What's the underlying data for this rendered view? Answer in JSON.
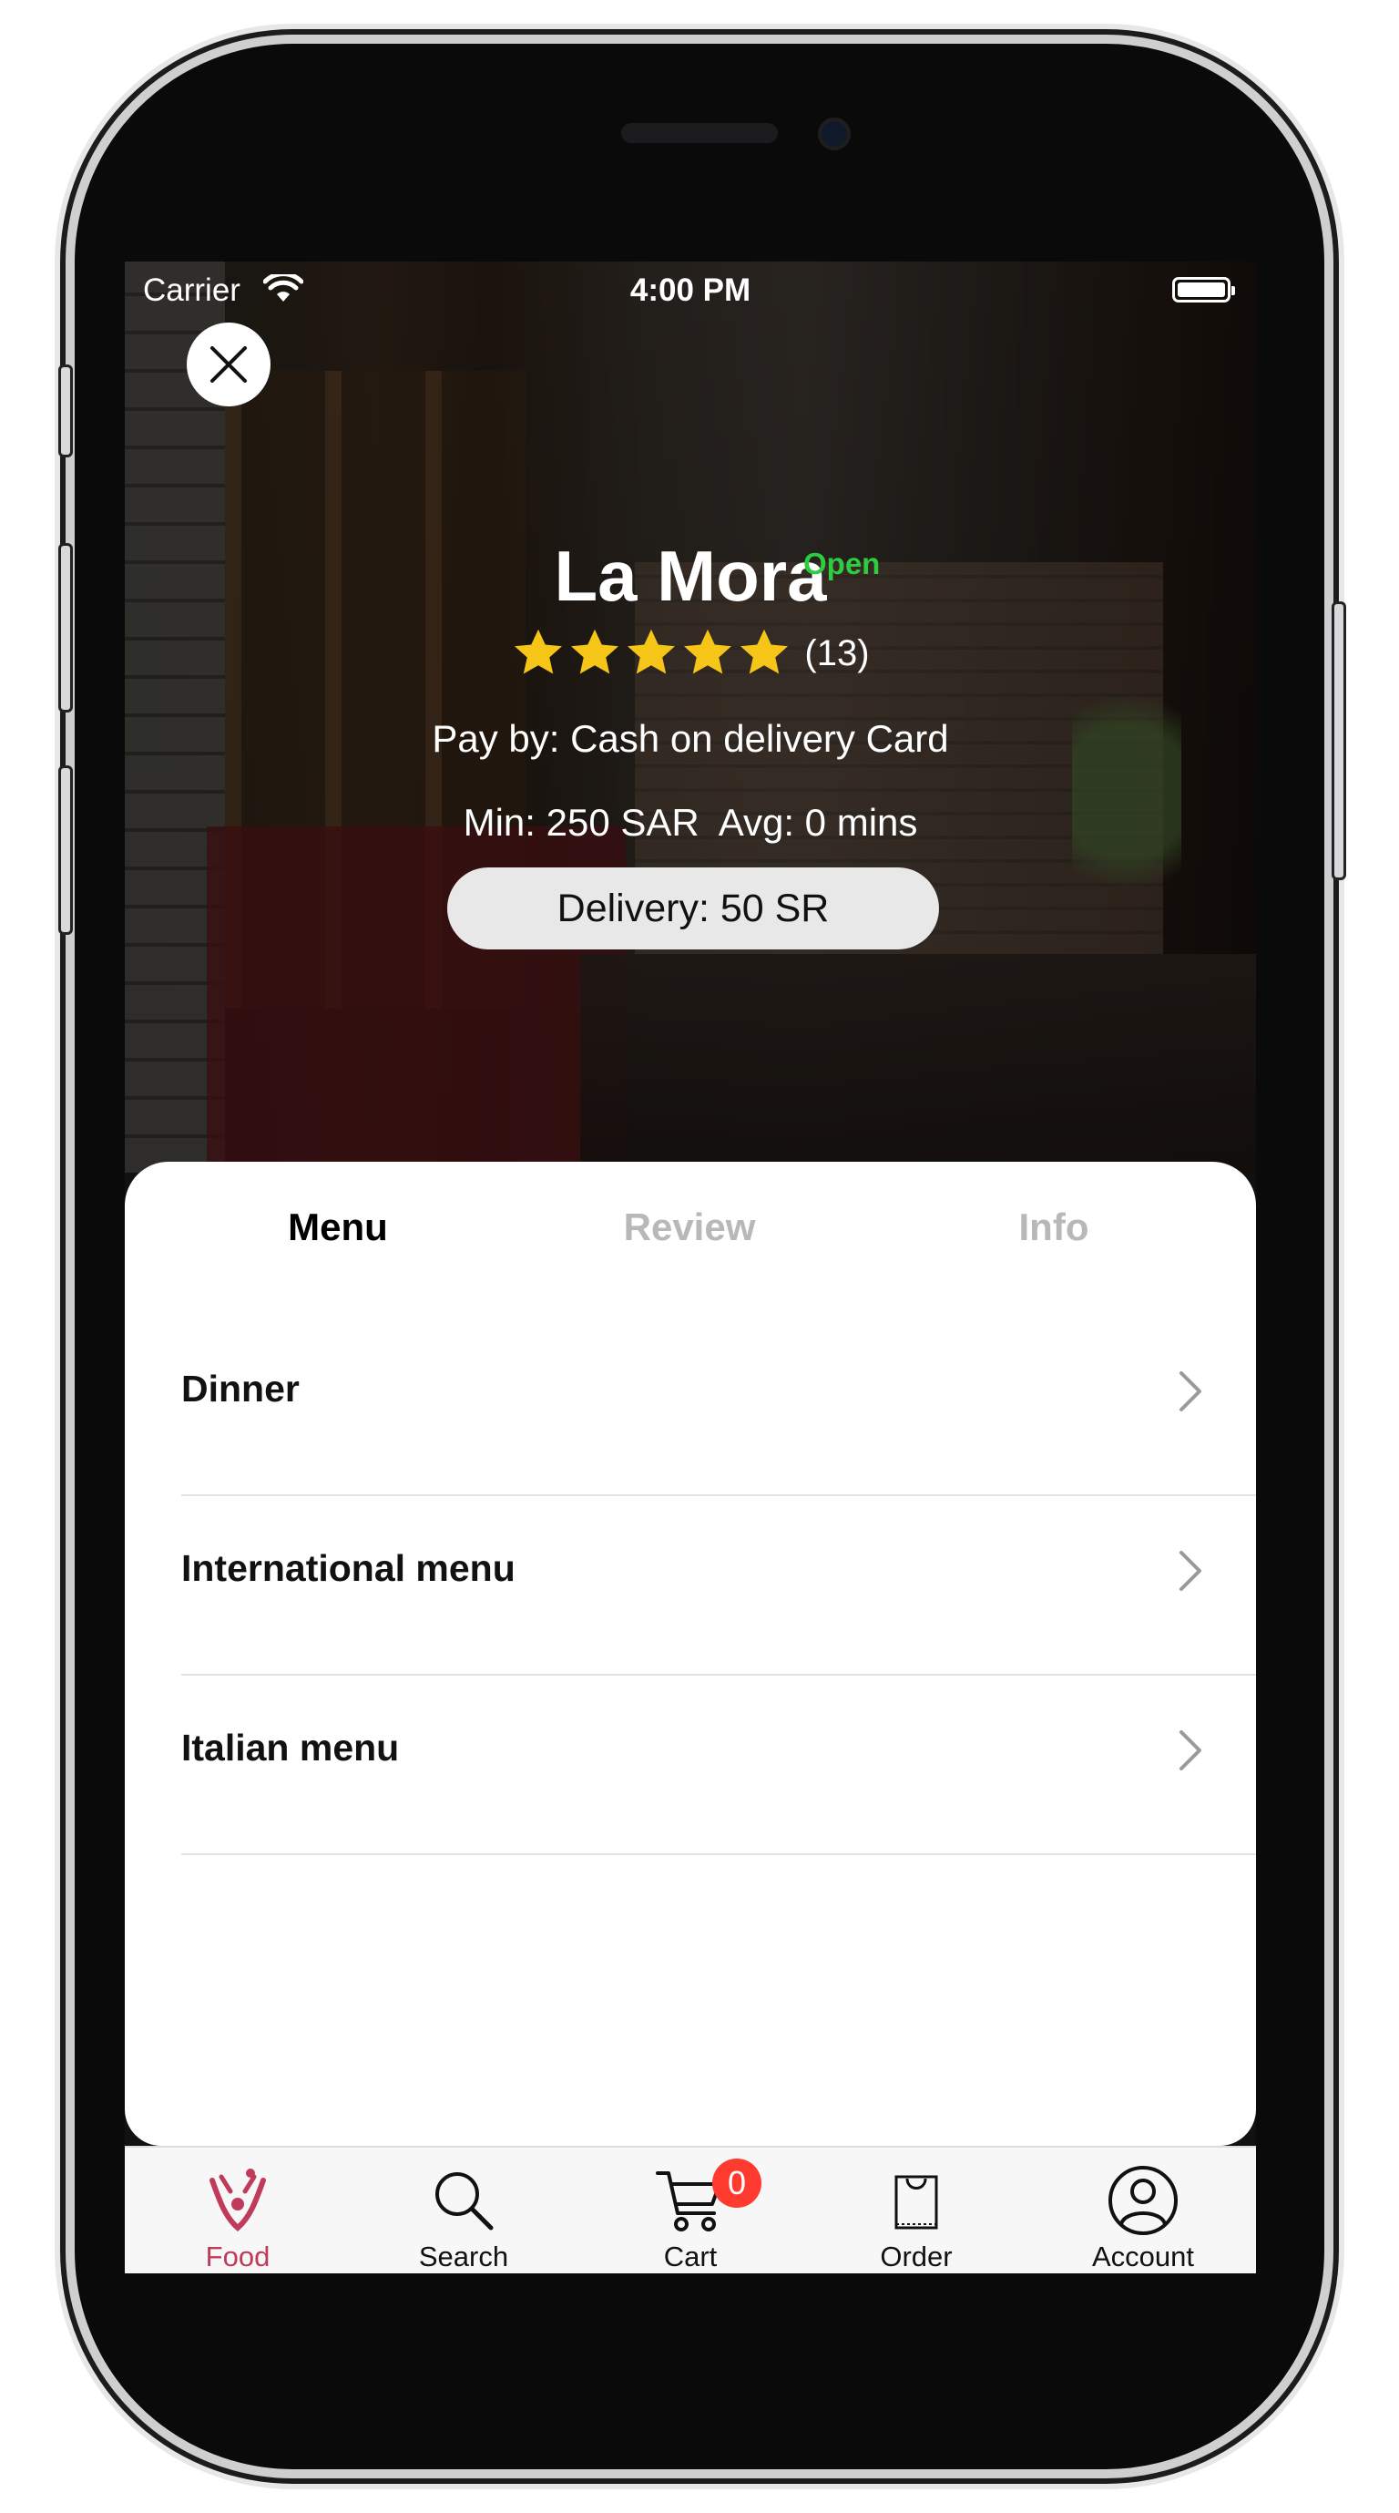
{
  "status_bar": {
    "carrier": "Carrier",
    "time": "4:00 PM"
  },
  "restaurant": {
    "name": "La Mora",
    "status": "Open",
    "rating": 5,
    "rating_max": 5,
    "rating_count": "(13)",
    "pay_by": "Pay by: Cash on delivery Card",
    "min_avg": "Min: 250 SAR  Avg: 0 mins",
    "delivery": "Delivery: 50 SR"
  },
  "tabs": [
    {
      "label": "Menu",
      "active": true
    },
    {
      "label": "Review",
      "active": false
    },
    {
      "label": "Info",
      "active": false
    }
  ],
  "menu_items": [
    {
      "label": "Dinner"
    },
    {
      "label": "International menu"
    },
    {
      "label": "Italian menu"
    }
  ],
  "tabbar": {
    "items": [
      {
        "label": "Food",
        "icon": "food-logo-icon",
        "active": true
      },
      {
        "label": "Search",
        "icon": "search-icon",
        "active": false
      },
      {
        "label": "Cart",
        "icon": "cart-icon",
        "active": false
      },
      {
        "label": "Order",
        "icon": "bag-icon",
        "active": false
      },
      {
        "label": "Account",
        "icon": "user-icon",
        "active": false
      }
    ],
    "cart_badge": "0"
  },
  "colors": {
    "accent": "#c03a5a",
    "open_green": "#2ecc40",
    "star": "#f5c518",
    "badge": "#ff3b30"
  }
}
